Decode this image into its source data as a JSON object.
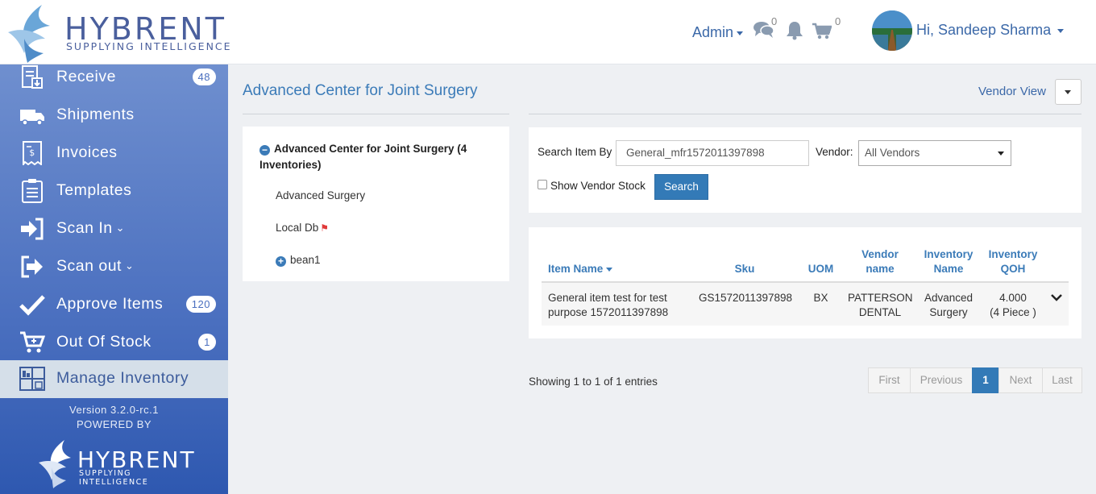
{
  "header": {
    "logo_brand": "HYBRENT",
    "logo_tagline": "SUPPLYING INTELLIGENCE",
    "admin_label": "Admin",
    "messages_count": "0",
    "cart_count": "0",
    "user_greeting": "Hi, Sandeep Sharma"
  },
  "sidebar": {
    "items": [
      {
        "label": "Receive",
        "badge": "48",
        "icon": "receive-icon"
      },
      {
        "label": "Shipments",
        "badge": "",
        "icon": "truck-icon"
      },
      {
        "label": "Invoices",
        "badge": "",
        "icon": "invoice-icon"
      },
      {
        "label": "Templates",
        "badge": "",
        "icon": "clipboard-icon"
      },
      {
        "label": "Scan In",
        "badge": "",
        "icon": "sign-in-icon"
      },
      {
        "label": "Scan out",
        "badge": "",
        "icon": "sign-out-icon"
      },
      {
        "label": "Approve Items",
        "badge": "120",
        "icon": "check-icon"
      },
      {
        "label": "Out Of Stock",
        "badge": "1",
        "icon": "cart-icon"
      },
      {
        "label": "Manage Inventory",
        "badge": "",
        "icon": "inventory-icon"
      }
    ],
    "version": "Version 3.2.0-rc.1",
    "powered_by": "POWERED BY",
    "footer_brand": "HYBRENT",
    "footer_tagline": "SUPPLYING INTELLIGENCE"
  },
  "main": {
    "page_title": "Advanced Center for Joint Surgery",
    "vendor_view": "Vendor View",
    "tree": {
      "root": "Advanced Center for Joint Surgery (4 Inventories)",
      "nodes": [
        "Advanced Surgery",
        "Local Db",
        "bean1"
      ]
    },
    "search": {
      "label": "Search Item By",
      "value": "General_mfr1572011397898",
      "vendor_label": "Vendor:",
      "vendor_value": "All Vendors",
      "show_vendor_stock": "Show Vendor Stock",
      "button": "Search"
    },
    "table": {
      "headers": [
        "Item Name",
        "Sku",
        "UOM",
        "Vendor name",
        "Inventory Name",
        "Inventory QOH"
      ],
      "rows": [
        {
          "item_name": "General item test for test purpose 1572011397898",
          "sku": "GS1572011397898",
          "uom": "BX",
          "vendor": "PATTERSON DENTAL",
          "inventory": "Advanced Surgery",
          "qoh": "4.000",
          "qoh_detail": "(4 Piece )"
        }
      ]
    },
    "showing": "Showing 1 to 1 of 1 entries",
    "pager": [
      "First",
      "Previous",
      "1",
      "Next",
      "Last"
    ]
  }
}
